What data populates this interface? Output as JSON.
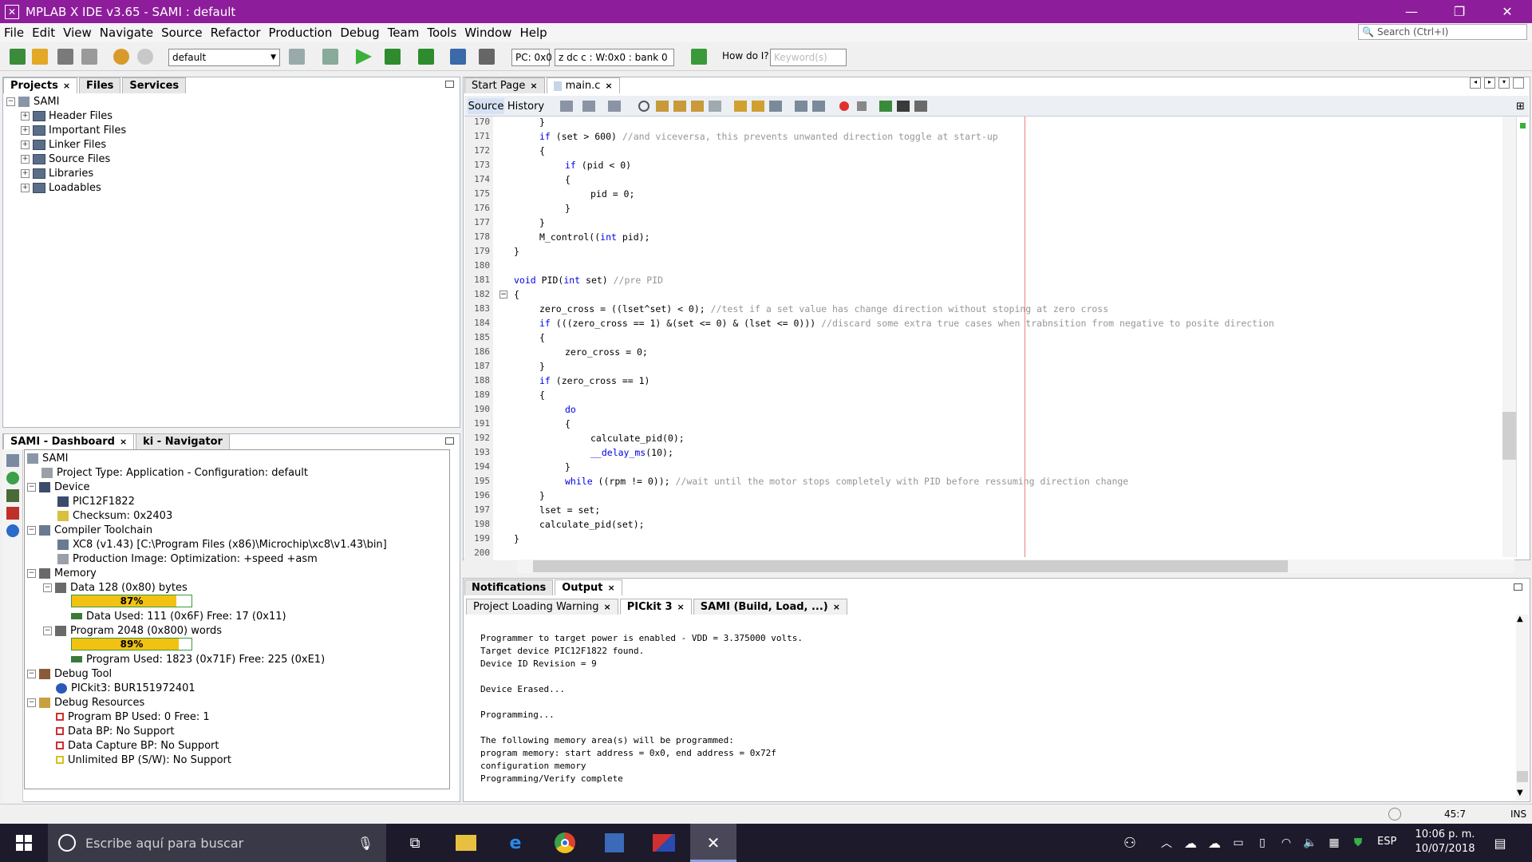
{
  "window": {
    "title": "MPLAB X IDE v3.65 - SAMI : default"
  },
  "menu": [
    "File",
    "Edit",
    "View",
    "Navigate",
    "Source",
    "Refactor",
    "Production",
    "Debug",
    "Team",
    "Tools",
    "Window",
    "Help"
  ],
  "search": {
    "placeholder": "Search (Ctrl+I)"
  },
  "toolbar": {
    "config": "default",
    "pc": "PC: 0x0",
    "status": "z dc c  : W:0x0 : bank 0",
    "howdoi": "How do I?",
    "keyword_placeholder": "Keyword(s)"
  },
  "projects_panel": {
    "tabs": [
      "Projects",
      "Files",
      "Services"
    ],
    "root": "SAMI",
    "items": [
      "Header Files",
      "Important Files",
      "Linker Files",
      "Source Files",
      "Libraries",
      "Loadables"
    ]
  },
  "dashboard": {
    "tabs": [
      "SAMI - Dashboard",
      "ki - Navigator"
    ],
    "root": "SAMI",
    "project_type": "Project Type: Application - Configuration: default",
    "device": "Device",
    "chip": "PIC12F1822",
    "checksum": "Checksum: 0x2403",
    "compiler": "Compiler Toolchain",
    "xc8": "XC8 (v1.43) [C:\\Program Files (x86)\\Microchip\\xc8\\v1.43\\bin]",
    "production_image": "Production Image: Optimization: +speed +asm",
    "memory": "Memory",
    "data_mem": "Data 128 (0x80) bytes",
    "data_pct_label": "87%",
    "data_pct": 87,
    "data_used": "Data Used: 111 (0x6F) Free: 17 (0x11)",
    "prog_mem": "Program 2048 (0x800) words",
    "prog_pct_label": "89%",
    "prog_pct": 89,
    "prog_used": "Program Used: 1823 (0x71F) Free: 225 (0xE1)",
    "debug_tool": "Debug Tool",
    "pickit": "PICkit3: BUR151972401",
    "debug_resources": "Debug Resources",
    "prog_bp": "Program BP Used: 0  Free: 1",
    "data_bp": "Data BP: No Support",
    "capture_bp": "Data Capture BP: No Support",
    "unlimited_bp": "Unlimited BP (S/W): No Support"
  },
  "editor": {
    "tabs": [
      "Start Page",
      "main.c"
    ],
    "subtabs": [
      "Source",
      "History"
    ],
    "lines": [
      {
        "n": "170",
        "i": 1,
        "t": [
          [
            "",
            "}"
          ]
        ]
      },
      {
        "n": "171",
        "i": 1,
        "t": [
          [
            "kw",
            "if"
          ],
          [
            "",
            " (set > 600) "
          ],
          [
            "cm",
            "//and viceversa, this prevents unwanted direction toggle at start-up"
          ]
        ]
      },
      {
        "n": "172",
        "i": 1,
        "t": [
          [
            "",
            "{"
          ]
        ]
      },
      {
        "n": "173",
        "i": 2,
        "t": [
          [
            "kw",
            "if"
          ],
          [
            "",
            " (pid < 0)"
          ]
        ]
      },
      {
        "n": "174",
        "i": 2,
        "t": [
          [
            "",
            "{"
          ]
        ]
      },
      {
        "n": "175",
        "i": 3,
        "t": [
          [
            "",
            "pid = 0;"
          ]
        ]
      },
      {
        "n": "176",
        "i": 2,
        "t": [
          [
            "",
            "}"
          ]
        ]
      },
      {
        "n": "177",
        "i": 1,
        "t": [
          [
            "",
            "}"
          ]
        ]
      },
      {
        "n": "178",
        "i": 1,
        "t": [
          [
            "",
            "M_control(("
          ],
          [
            "kw",
            "int"
          ],
          [
            "",
            " pid);"
          ]
        ]
      },
      {
        "n": "179",
        "i": 0,
        "t": [
          [
            "",
            "}"
          ]
        ]
      },
      {
        "n": "180",
        "i": 0,
        "t": []
      },
      {
        "n": "181",
        "i": 0,
        "t": [
          [
            "kw",
            "void"
          ],
          [
            "",
            " PID("
          ],
          [
            "kw",
            "int"
          ],
          [
            "",
            " set) "
          ],
          [
            "cm",
            "//pre PID"
          ]
        ]
      },
      {
        "n": "182",
        "i": 0,
        "t": [
          [
            "",
            "{"
          ]
        ]
      },
      {
        "n": "183",
        "i": 1,
        "t": [
          [
            "",
            "zero_cross = ((lset^set) < 0); "
          ],
          [
            "cm",
            "//test if a set value has change direction without stoping at zero cross"
          ]
        ]
      },
      {
        "n": "184",
        "i": 1,
        "t": [
          [
            "kw",
            "if"
          ],
          [
            "",
            " (((zero_cross == 1) &(set <= 0) & (lset <= 0))) "
          ],
          [
            "cm",
            "//discard some extra true cases when trabnsition from negative to posite direction"
          ]
        ]
      },
      {
        "n": "185",
        "i": 1,
        "t": [
          [
            "",
            "{"
          ]
        ]
      },
      {
        "n": "186",
        "i": 2,
        "t": [
          [
            "",
            "zero_cross = 0;"
          ]
        ]
      },
      {
        "n": "187",
        "i": 1,
        "t": [
          [
            "",
            "}"
          ]
        ]
      },
      {
        "n": "188",
        "i": 1,
        "t": [
          [
            "kw",
            "if"
          ],
          [
            "",
            " (zero_cross == 1)"
          ]
        ]
      },
      {
        "n": "189",
        "i": 1,
        "t": [
          [
            "",
            "{"
          ]
        ]
      },
      {
        "n": "190",
        "i": 2,
        "t": [
          [
            "kw",
            "do"
          ]
        ]
      },
      {
        "n": "191",
        "i": 2,
        "t": [
          [
            "",
            "{"
          ]
        ]
      },
      {
        "n": "192",
        "i": 3,
        "t": [
          [
            "",
            "calculate_pid(0);"
          ]
        ]
      },
      {
        "n": "193",
        "i": 3,
        "t": [
          [
            "fn",
            "__delay_ms"
          ],
          [
            "",
            "(10);"
          ]
        ]
      },
      {
        "n": "194",
        "i": 2,
        "t": [
          [
            "",
            "}"
          ]
        ]
      },
      {
        "n": "195",
        "i": 2,
        "t": [
          [
            "kw",
            "while"
          ],
          [
            "",
            " ((rpm != 0)); "
          ],
          [
            "cm",
            "//wait until the motor stops completely with PID before ressuming direction change"
          ]
        ]
      },
      {
        "n": "196",
        "i": 1,
        "t": [
          [
            "",
            "}"
          ]
        ]
      },
      {
        "n": "197",
        "i": 1,
        "t": [
          [
            "",
            "lset = set;"
          ]
        ]
      },
      {
        "n": "198",
        "i": 1,
        "t": [
          [
            "",
            "calculate_pid(set);"
          ]
        ]
      },
      {
        "n": "199",
        "i": 0,
        "t": [
          [
            "",
            "}"
          ]
        ]
      },
      {
        "n": "200",
        "i": 0,
        "t": []
      }
    ]
  },
  "output": {
    "tabs": [
      "Notifications",
      "Output"
    ],
    "subtabs": [
      "Project Loading Warning",
      "PICkit 3",
      "SAMI (Build, Load, ...)"
    ],
    "lines": [
      "Programmer to target power is enabled - VDD = 3.375000 volts.",
      "Target device PIC12F1822 found.",
      "Device ID Revision = 9",
      "",
      "Device Erased...",
      "",
      "Programming...",
      "",
      "The following memory area(s) will be programmed:",
      "program memory: start address = 0x0, end address = 0x72f",
      "configuration memory",
      "Programming/Verify complete"
    ]
  },
  "statusbar": {
    "position": "45:7",
    "mode": "INS"
  },
  "taskbar": {
    "search": "Escribe aquí para buscar",
    "lang": "ESP",
    "time": "10:06 p. m.",
    "date": "10/07/2018"
  }
}
